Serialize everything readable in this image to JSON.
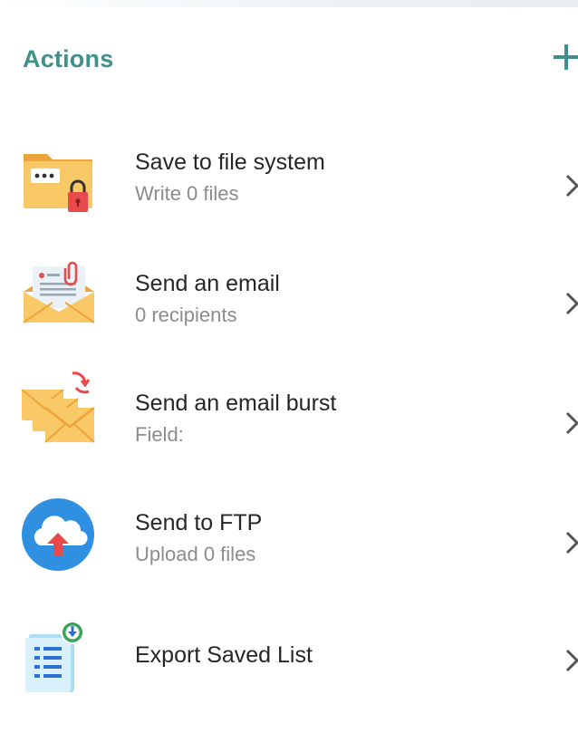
{
  "panel": {
    "title": "Actions",
    "add_icon": "plus-icon"
  },
  "colors": {
    "title": "#3f8f8a",
    "label": "#262626",
    "sub": "#8c8c8c",
    "chevron": "#555555"
  },
  "actions": [
    {
      "label": "Save to file system",
      "sub": "Write 0 files",
      "icon": "folder-lock-icon"
    },
    {
      "label": "Send an email",
      "sub": "0 recipients",
      "icon": "email-icon"
    },
    {
      "label": "Send an email burst",
      "sub": "Field:",
      "icon": "email-burst-icon"
    },
    {
      "label": "Send to FTP",
      "sub": "Upload 0 files",
      "icon": "ftp-upload-icon"
    },
    {
      "label": "Export Saved List",
      "sub": "",
      "icon": "export-list-icon"
    }
  ]
}
